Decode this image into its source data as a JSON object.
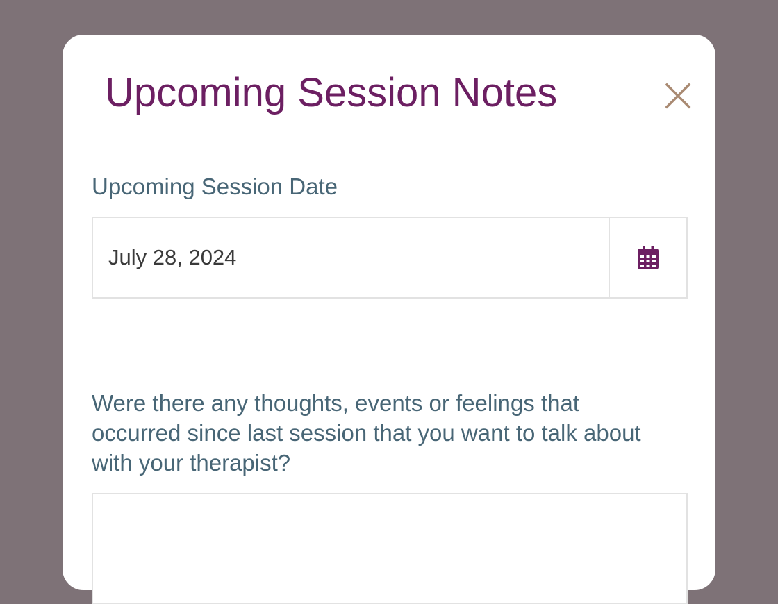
{
  "modal": {
    "title": "Upcoming Session Notes",
    "close_icon": "close-icon"
  },
  "date_section": {
    "label": "Upcoming Session Date",
    "value": "July 28, 2024",
    "calendar_icon": "calendar-icon"
  },
  "notes_section": {
    "question": "Were there any thoughts, events or feelings that occurred since last session that you want to talk about with your therapist?",
    "value": ""
  },
  "colors": {
    "backdrop": "#7e7277",
    "title": "#6c1f62",
    "label": "#486676",
    "close_icon": "#a98a72",
    "calendar_icon": "#6c1f62",
    "border": "#e2e2e2"
  }
}
